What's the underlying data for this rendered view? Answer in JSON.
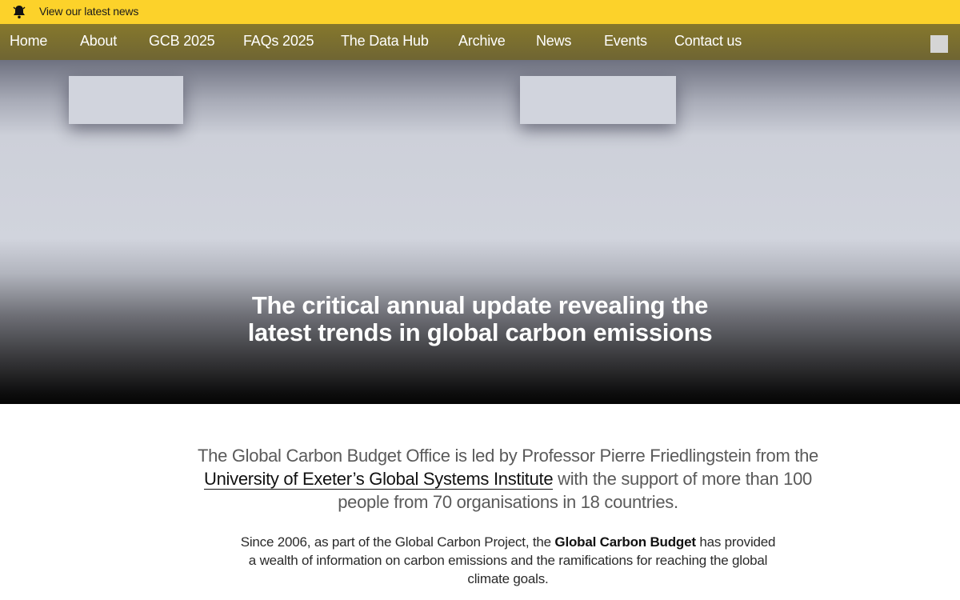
{
  "news_bar": {
    "icon": "bell-icon",
    "link_label": "View our latest news",
    "background": "#fcd22a"
  },
  "nav": {
    "items": [
      {
        "label": "Home"
      },
      {
        "label": "About"
      },
      {
        "label": "GCB 2025"
      },
      {
        "label": "FAQs 2025"
      },
      {
        "label": "The Data Hub"
      },
      {
        "label": "Archive"
      },
      {
        "label": "News"
      },
      {
        "label": "Events"
      },
      {
        "label": "Contact us"
      }
    ]
  },
  "hero": {
    "tagline_line1": "The critical annual update revealing the",
    "tagline_line2": "latest trends in global carbon emissions"
  },
  "intro": {
    "text_before": "The Global Carbon Budget Office is led by Professor Pierre Friedlingstein from the ",
    "link_label": "University of Exeter’s Global Systems Institute",
    "text_after": " with the support of more than 100 people from 70 organisations in 18 countries."
  },
  "body": {
    "text_before": "Since 2006, as part of the Global Carbon Project, the ",
    "bold_label": "Global Carbon Budget",
    "text_after": " has provided a wealth of information on carbon emissions and the ramifications for reaching the global climate goals."
  }
}
